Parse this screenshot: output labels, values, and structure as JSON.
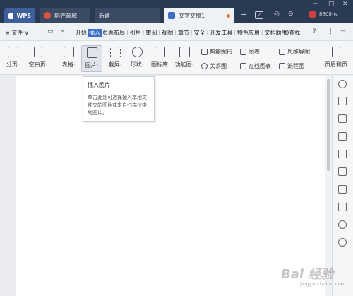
{
  "titlebar": {
    "tabs": [
      {
        "label": "WPS"
      },
      {
        "label": "稻壳商城"
      },
      {
        "label": "新建"
      },
      {
        "label": "文字文稿1"
      }
    ],
    "plus": "+",
    "badge": "2",
    "user": "8808-rc"
  },
  "menubar": {
    "file": "≡ 文件 ∨",
    "items": [
      "开始",
      "插入",
      "页面布局",
      "引用",
      "审阅",
      "视图",
      "章节",
      "安全",
      "开发工具",
      "特色应用",
      "文档助手"
    ],
    "selected": "插入",
    "search": "Q查找",
    "help": "?"
  },
  "ribbon": {
    "pagebreak": "分页·",
    "blank_page": "空白页·",
    "table": "表格·",
    "picture": "图片·",
    "screenshot": "截屏·",
    "shape": "形状·",
    "icon_lib": "图标库",
    "function_chart": "功能图·",
    "smart_shape": "智能图形",
    "chart": "图表",
    "mindmap": "思维导图",
    "relation": "关系图",
    "online_chart": "在线图表",
    "flowchart": "流程图",
    "header_footer": "页眉和页"
  },
  "tooltip": {
    "title": "插入图片",
    "body": "单击此处可选择插入本地文件夹的图片或来自扫描仪中的图片。"
  },
  "watermark": {
    "logo": "Bai 经验",
    "url": "jingyan.baidu.com"
  },
  "colors": {
    "titlebar": "#2a3a52",
    "accent": "#3b6fc6",
    "page": "#ffffff"
  }
}
